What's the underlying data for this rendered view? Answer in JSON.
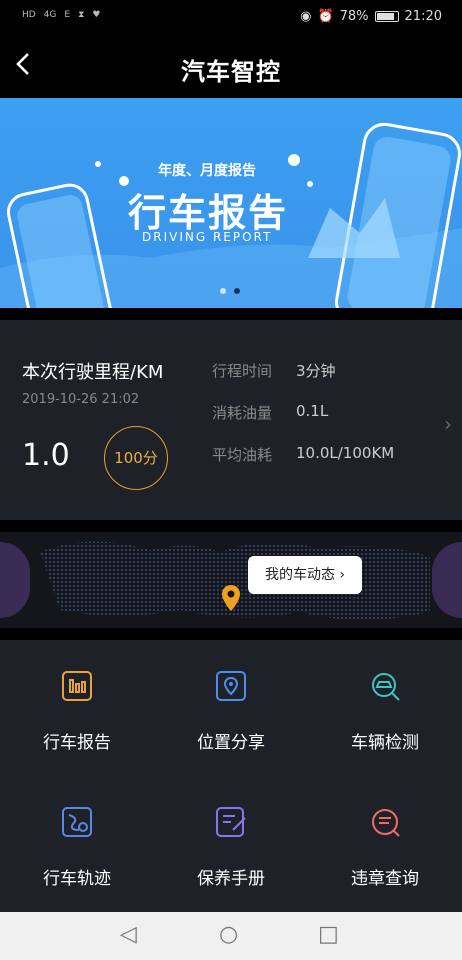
{
  "status_bar": {
    "left_icons": [
      "HD",
      "4G",
      "E",
      "hourglass-icon",
      "heart-rate-icon"
    ],
    "battery": "78%",
    "time": "21:20"
  },
  "header": {
    "back_icon": "back-arrow-icon",
    "title": "汽车智控"
  },
  "banner": {
    "subtitle": "年度、月度报告",
    "headline": "行车报告",
    "english": "DRIVING REPORT",
    "page_count": 2,
    "active_page": 2
  },
  "trip": {
    "label": "本次行驶里程/KM",
    "date": "2019-10-26 21:02",
    "distance": "1.0",
    "score": "100分",
    "stats": [
      {
        "key": "行程时间",
        "value": "3分钟"
      },
      {
        "key": "消耗油量",
        "value": "0.1L"
      },
      {
        "key": "平均油耗",
        "value": "10.0L/100KM"
      }
    ]
  },
  "map": {
    "bubble": "我的车动态"
  },
  "features": [
    {
      "label": "行车报告",
      "icon": "report-chart-icon",
      "color": "#e8a33a"
    },
    {
      "label": "位置分享",
      "icon": "location-share-icon",
      "color": "#4a8ff0"
    },
    {
      "label": "车辆检测",
      "icon": "car-inspect-icon",
      "color": "#3fc5c0"
    },
    {
      "label": "行车轨迹",
      "icon": "route-track-icon",
      "color": "#5a86e6"
    },
    {
      "label": "保养手册",
      "icon": "maintenance-book-icon",
      "color": "#8a72f0"
    },
    {
      "label": "违章查询",
      "icon": "violation-query-icon",
      "color": "#f06a6a"
    }
  ],
  "colors": {
    "banner": "#3c9ff0",
    "panel": "#1f2129",
    "accent": "#e8b040"
  }
}
